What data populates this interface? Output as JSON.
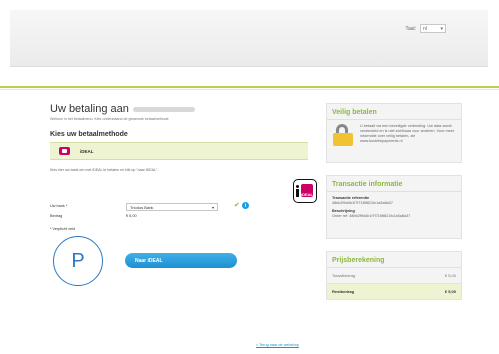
{
  "header": {
    "lang_label": "Taal:",
    "lang_value": "nl"
  },
  "main": {
    "title": "Uw betaling aan",
    "welcome": "Welkom in het betaalmenu. Kies onderstaand de gewenste betaalmethode",
    "method_heading": "Kies uw betaalmethode",
    "method_label": "iDEAL",
    "instruction": "Kies hier uw bank om met iDEAL te betalen en klik op \"naar iDEAL\".",
    "bank_label": "Uw bank *",
    "bank_value": "Triodos Bank",
    "amount_label": "Bedrag",
    "amount_value": "€ 5,00",
    "required_note": "* Verplicht veld",
    "pay_button": "Naar iDEAL",
    "back_link": "< Terug naar de webshop",
    "logo_text": "iDEAL"
  },
  "overlay": {
    "letter": "P"
  },
  "secure": {
    "title": "Veilig betalen",
    "text": "U betaalt via een beveiligde verbinding. Uw data wordt versleuteld en is niet zichtbaar voor anderen. Voor meer informatie over veilig betalen, zie www.bookitsipayments.nl"
  },
  "transaction": {
    "title": "Transactie informatie",
    "ref_label": "Transactie referentie",
    "ref_value": "48bb2f9d4b1f7f71f8f821fc1a5a8a37",
    "desc_label": "Beschrijving",
    "desc_value": "Order ref: 48bb2f9d4b1f7f71f8f821fc1a5a8a37"
  },
  "pricing": {
    "title": "Prijsberekening",
    "total_label": "Totaalbedrag",
    "total_value": "€ 5,00",
    "rest_label": "Restbedrag",
    "rest_value": "€ 5,00"
  },
  "colors": {
    "accent_green": "#8cb73d",
    "button_blue": "#1f8fd0",
    "ideal_pink": "#cc0066"
  }
}
